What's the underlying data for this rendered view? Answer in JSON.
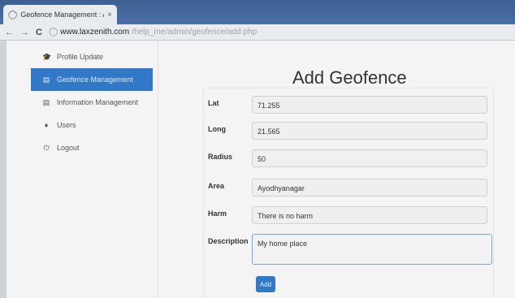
{
  "browser": {
    "tab_title": "Geofence Management : A",
    "tab_close": "×",
    "url_host": "www.laxzenith.com",
    "url_path": "/help_me/admin/geofence/add.php",
    "back": "←",
    "forward": "→",
    "reload": "C"
  },
  "sidebar": {
    "items": [
      {
        "label": "Profile Update",
        "icon": "graduation-cap-icon",
        "glyph": "🎓"
      },
      {
        "label": "Geofence Management",
        "icon": "document-icon",
        "glyph": "▤"
      },
      {
        "label": "Information Management",
        "icon": "document-icon",
        "glyph": "▤"
      },
      {
        "label": "Users",
        "icon": "user-icon",
        "glyph": "♦"
      },
      {
        "label": "Logout",
        "icon": "power-icon",
        "glyph": "⏻"
      }
    ],
    "active_index": 1
  },
  "main": {
    "title": "Add Geofence",
    "fields": [
      {
        "label": "Lat",
        "value": "71.255"
      },
      {
        "label": "Long",
        "value": "21.565"
      },
      {
        "label": "Radius",
        "value": "50"
      },
      {
        "label": "Area",
        "value": "Ayodhyanagar"
      },
      {
        "label": "Harm",
        "value": "There is no harm"
      },
      {
        "label": "Description",
        "value": "My home place"
      }
    ],
    "submit_label": "Add"
  },
  "colors": {
    "accent": "#3178c6",
    "tabstrip": "#4a6fa5"
  }
}
